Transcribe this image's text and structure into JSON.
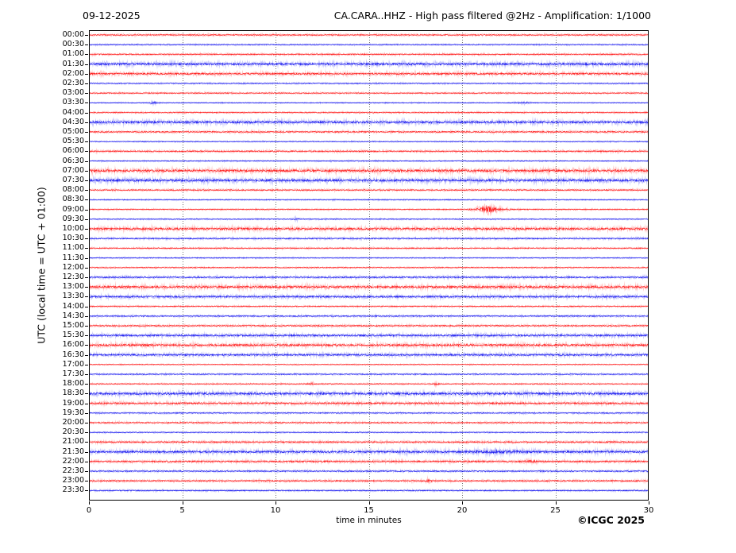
{
  "header": {
    "date": "09-12-2025",
    "title": "CA.CARA..HHZ - High pass filtered @2Hz - Amplification: 1/1000"
  },
  "axes": {
    "ylabel": "UTC (local time = UTC + 01:00)",
    "xlabel": "time in minutes",
    "xticks": [
      0,
      5,
      10,
      15,
      20,
      25,
      30
    ],
    "xlim": [
      0,
      30
    ],
    "grid_minutes": [
      5,
      10,
      15,
      20,
      25
    ],
    "grid_style": "dotted-vertical"
  },
  "footer": {
    "copyright": "©ICGC 2025"
  },
  "colors": {
    "trace_red": "#ff0000",
    "trace_blue": "#0000ee",
    "grid": "#666666",
    "axis": "#000000",
    "background": "#ffffff"
  },
  "chart_data": {
    "type": "line",
    "subtype": "helicorder-dayplot",
    "station": "CA.CARA..HHZ",
    "filter": "High pass filtered @2Hz",
    "amplification": "1/1000",
    "date": "09-12-2025",
    "minutes_per_line": 30,
    "legend_position": "none",
    "grid": true,
    "rows": [
      {
        "label": "00:00",
        "color": "red",
        "noise": 0.8,
        "events": []
      },
      {
        "label": "00:30",
        "color": "blue",
        "noise": 0.6,
        "events": []
      },
      {
        "label": "01:00",
        "color": "red",
        "noise": 0.8,
        "events": []
      },
      {
        "label": "01:30",
        "color": "blue",
        "noise": 1.6,
        "events": []
      },
      {
        "label": "02:00",
        "color": "red",
        "noise": 1.3,
        "events": []
      },
      {
        "label": "02:30",
        "color": "blue",
        "noise": 0.6,
        "events": []
      },
      {
        "label": "03:00",
        "color": "red",
        "noise": 0.7,
        "events": []
      },
      {
        "label": "03:30",
        "color": "blue",
        "noise": 0.5,
        "events": [
          {
            "t_min": 3.45,
            "amp": 1.4,
            "w_min": 0.12
          },
          {
            "t_min": 23.3,
            "amp": 0.7,
            "w_min": 0.3
          }
        ]
      },
      {
        "label": "04:00",
        "color": "red",
        "noise": 0.7,
        "events": []
      },
      {
        "label": "04:30",
        "color": "blue",
        "noise": 1.6,
        "events": []
      },
      {
        "label": "05:00",
        "color": "red",
        "noise": 0.9,
        "events": []
      },
      {
        "label": "05:30",
        "color": "blue",
        "noise": 0.5,
        "events": []
      },
      {
        "label": "06:00",
        "color": "red",
        "noise": 0.9,
        "events": []
      },
      {
        "label": "06:30",
        "color": "blue",
        "noise": 0.55,
        "events": []
      },
      {
        "label": "07:00",
        "color": "red",
        "noise": 1.7,
        "events": []
      },
      {
        "label": "07:30",
        "color": "blue",
        "noise": 1.7,
        "events": []
      },
      {
        "label": "08:00",
        "color": "red",
        "noise": 0.8,
        "events": []
      },
      {
        "label": "08:30",
        "color": "blue",
        "noise": 0.55,
        "events": []
      },
      {
        "label": "09:00",
        "color": "red",
        "noise": 0.6,
        "events": [
          {
            "t_min": 21.4,
            "amp": 3.2,
            "w_min": 0.3
          },
          {
            "t_min": 21.5,
            "amp": 1.1,
            "w_min": 0.7
          }
        ]
      },
      {
        "label": "09:30",
        "color": "blue",
        "noise": 0.55,
        "events": [
          {
            "t_min": 11.1,
            "amp": 1.2,
            "w_min": 0.1
          }
        ]
      },
      {
        "label": "10:00",
        "color": "red",
        "noise": 1.5,
        "events": []
      },
      {
        "label": "10:30",
        "color": "blue",
        "noise": 0.8,
        "events": []
      },
      {
        "label": "11:00",
        "color": "red",
        "noise": 0.7,
        "events": []
      },
      {
        "label": "11:30",
        "color": "blue",
        "noise": 0.55,
        "events": []
      },
      {
        "label": "12:00",
        "color": "red",
        "noise": 0.6,
        "events": []
      },
      {
        "label": "12:30",
        "color": "blue",
        "noise": 1.0,
        "events": []
      },
      {
        "label": "13:00",
        "color": "red",
        "noise": 1.6,
        "events": []
      },
      {
        "label": "13:30",
        "color": "blue",
        "noise": 1.3,
        "events": []
      },
      {
        "label": "14:00",
        "color": "red",
        "noise": 0.7,
        "events": []
      },
      {
        "label": "14:30",
        "color": "blue",
        "noise": 0.8,
        "events": []
      },
      {
        "label": "15:00",
        "color": "red",
        "noise": 0.9,
        "events": []
      },
      {
        "label": "15:30",
        "color": "blue",
        "noise": 1.3,
        "events": []
      },
      {
        "label": "16:00",
        "color": "red",
        "noise": 1.5,
        "events": []
      },
      {
        "label": "16:30",
        "color": "blue",
        "noise": 1.3,
        "events": []
      },
      {
        "label": "17:00",
        "color": "red",
        "noise": 0.5,
        "events": []
      },
      {
        "label": "17:30",
        "color": "blue",
        "noise": 0.7,
        "events": []
      },
      {
        "label": "18:00",
        "color": "red",
        "noise": 0.6,
        "events": [
          {
            "t_min": 11.9,
            "amp": 1.6,
            "w_min": 0.1
          },
          {
            "t_min": 18.6,
            "amp": 1.0,
            "w_min": 0.1
          }
        ]
      },
      {
        "label": "18:30",
        "color": "blue",
        "noise": 1.6,
        "events": []
      },
      {
        "label": "19:00",
        "color": "red",
        "noise": 1.2,
        "events": []
      },
      {
        "label": "19:30",
        "color": "blue",
        "noise": 0.7,
        "events": []
      },
      {
        "label": "20:00",
        "color": "red",
        "noise": 0.8,
        "events": []
      },
      {
        "label": "20:30",
        "color": "blue",
        "noise": 0.6,
        "events": []
      },
      {
        "label": "21:00",
        "color": "red",
        "noise": 1.0,
        "events": []
      },
      {
        "label": "21:30",
        "color": "blue",
        "noise": 1.5,
        "events": [
          {
            "t_min": 21.8,
            "amp": 1.1,
            "w_min": 1.0
          }
        ]
      },
      {
        "label": "22:00",
        "color": "red",
        "noise": 1.1,
        "events": [
          {
            "t_min": 23.6,
            "amp": 0.8,
            "w_min": 0.25
          }
        ]
      },
      {
        "label": "22:30",
        "color": "blue",
        "noise": 0.8,
        "events": []
      },
      {
        "label": "23:00",
        "color": "red",
        "noise": 0.9,
        "events": [
          {
            "t_min": 18.2,
            "amp": 1.4,
            "w_min": 0.1
          }
        ]
      },
      {
        "label": "23:30",
        "color": "blue",
        "noise": 0.7,
        "events": []
      }
    ]
  }
}
